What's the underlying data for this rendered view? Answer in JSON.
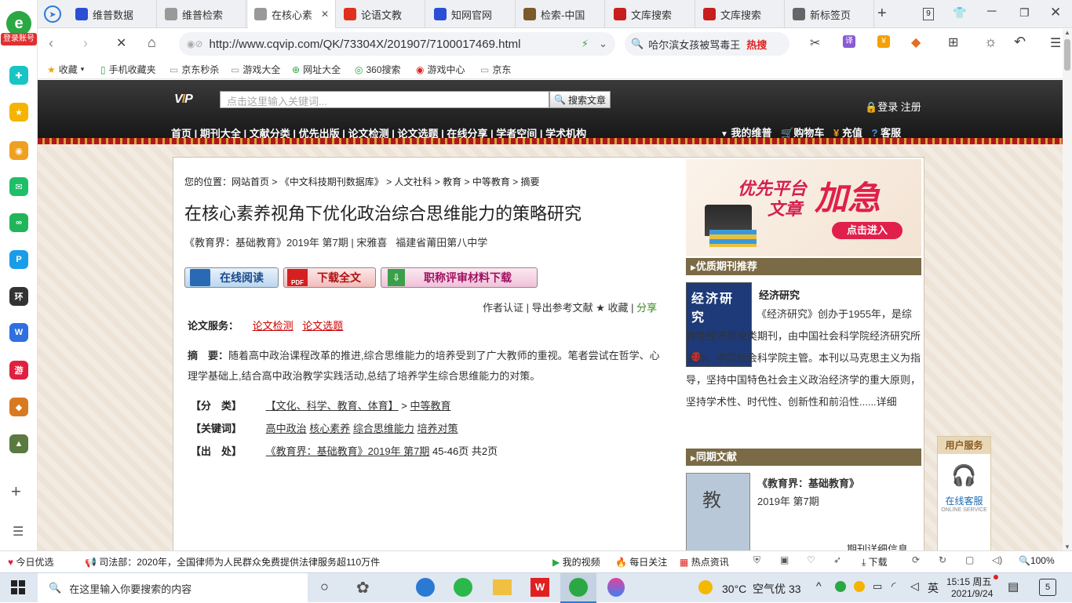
{
  "sidebar": {
    "login_label": "登录账号"
  },
  "tabs": [
    {
      "label": "维普数据",
      "fav": "paw-icon",
      "color": "#2a4fd4"
    },
    {
      "label": "维普检索",
      "fav": "globe-icon",
      "color": "#999999"
    },
    {
      "label": "在核心素",
      "fav": "globe-icon",
      "color": "#999999"
    },
    {
      "label": "论语文教",
      "fav": "doc-icon",
      "color": "#e0301e"
    },
    {
      "label": "知网官网",
      "fav": "paw-icon",
      "color": "#2a4fd4"
    },
    {
      "label": "检索-中国",
      "fav": "zhi-icon",
      "color": "#7a5a2a"
    },
    {
      "label": "文库搜索",
      "fav": "doc-icon",
      "color": "#c81e1e"
    },
    {
      "label": "文库搜索",
      "fav": "doc-icon",
      "color": "#c81e1e"
    },
    {
      "label": "新标签页",
      "fav": "newtab-icon",
      "color": "#666666"
    }
  ],
  "tab_count": "9",
  "address": {
    "url": "http://www.cqvip.com/QK/73304X/201907/7100017469.html",
    "search_text": "哈尔滨女孩被骂毒王",
    "hot_label": "热搜"
  },
  "bookmarks": [
    "收藏",
    "手机收藏夹",
    "京东秒杀",
    "游戏大全",
    "网址大全",
    "360搜索",
    "游戏中心",
    "京东"
  ],
  "site": {
    "search_placeholder": "点击这里输入关键词...",
    "search_button": "搜索文章",
    "login": "登录 注册",
    "nav": [
      "首页",
      "期刊大全",
      "文献分类",
      "优先出版",
      "论文检测",
      "论文选题",
      "在线分享",
      "学者空间",
      "学术机构"
    ],
    "user_links": [
      "我的维普",
      "购物车",
      "充值",
      "客服"
    ]
  },
  "article": {
    "breadcrumb_prefix": "您的位置：",
    "breadcrumb": [
      "网站首页",
      "《中文科技期刊数据库》",
      "人文社科",
      "教育",
      "中等教育",
      "摘要"
    ],
    "title": "在核心素养视角下优化政治综合思维能力的策略研究",
    "meta": "《教育界：基础教育》2019年 第7期 | 宋雅喜   福建省莆田第八中学",
    "btn_read": "在线阅读",
    "btn_download": "下载全文",
    "btn_materials": "职称评审材料下载",
    "actions": "作者认证 | 导出参考文献 ★ 收藏 |",
    "share": "分享",
    "service_label": "论文服务：",
    "service_links": [
      "论文检测",
      "论文选题"
    ],
    "abstract_label": "摘　要：",
    "abstract": "随着高中政治课程改革的推进,综合思维能力的培养受到了广大教师的重视。笔者尝试在哲学、心理学基础上,结合高中政治教学实践活动,总结了培养学生综合思维能力的对策。",
    "cat_label": "【分　类】",
    "cat_link": "【文化、科学、教育、体育】",
    "cat_sub": "中等教育",
    "kw_label": "【关键词】",
    "keywords": [
      "高中政治",
      "核心素养",
      "综合思维能力",
      "培养对策"
    ],
    "src_label": "【出　处】",
    "src_link": "《教育界：基础教育》2019年 第7期",
    "src_pages": "45-46页 共2页"
  },
  "right": {
    "ad_line1": "优先平台",
    "ad_line2": "文章",
    "ad_big": "加急",
    "ad_btn": "点击进入",
    "rec_head": "优质期刊推荐",
    "journal_name": "经济研究",
    "journal_desc": "《经济研究》创办于1955年，是综合性经济理论类期刊，由中国社会科学院经济研究所主办，中国社会科学院主管。本刊以马克思主义为指导，坚持中国特色社会主义政治经济学的重大原则，坚持学术性、时代性、创新性和前沿性......详细",
    "cover_title": "经济研究",
    "same_head": "同期文献",
    "same_journal": "《教育界：基础教育》",
    "same_issue": "2019年 第7期",
    "same_more": "期刊详细信息"
  },
  "service_widget": {
    "title": "用户服务",
    "label": "在线客服",
    "sub": "ONLINE SERVICE"
  },
  "statusbar": {
    "today": "今日优选",
    "news": "司法部：2020年，全国律师为人民群众免费提供法律服务超110万件",
    "video": "我的视频",
    "daily": "每日关注",
    "hot": "热点资讯",
    "download": "下载",
    "zoom": "100%"
  },
  "taskbar": {
    "search_placeholder": "在这里输入你要搜索的内容",
    "weather": "30°C  空气优 33",
    "ime": "英",
    "time": "15:15 周五",
    "date": "2021/9/24",
    "notif": "5"
  }
}
